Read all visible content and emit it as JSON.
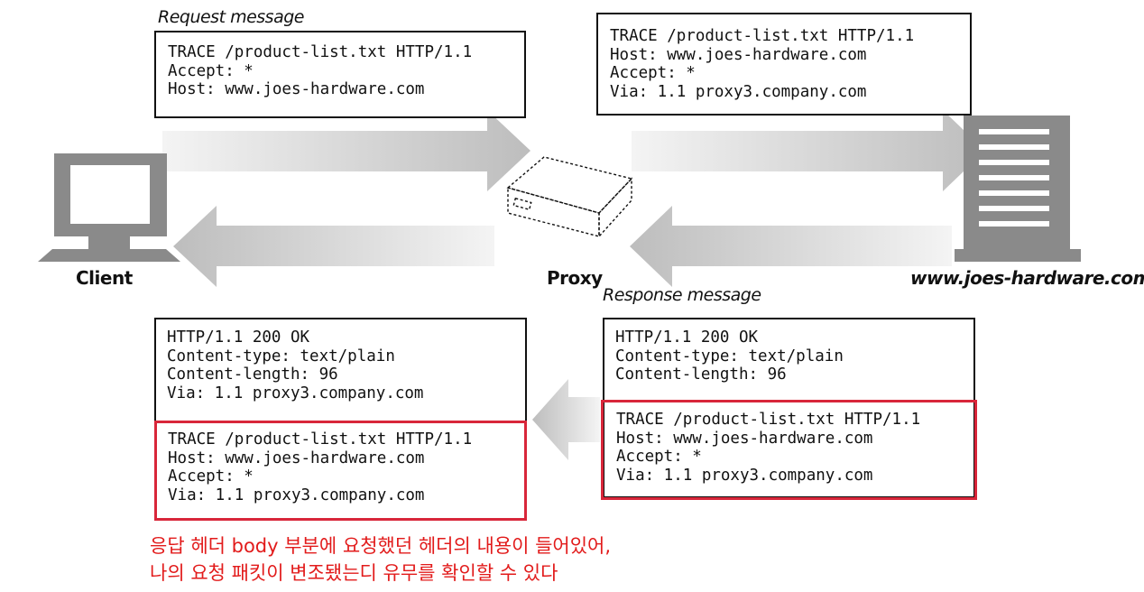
{
  "request": {
    "caption": "Request message",
    "client_box": [
      "TRACE /product-list.txt HTTP/1.1",
      "Accept: *",
      "Host: www.joes-hardware.com"
    ],
    "proxy_box": [
      "TRACE /product-list.txt HTTP/1.1",
      "Host: www.joes-hardware.com",
      "Accept: *",
      "Via: 1.1 proxy3.company.com"
    ]
  },
  "response": {
    "caption": "Response message",
    "client_box": {
      "headers": [
        "HTTP/1.1 200 OK",
        "Content-type: text/plain",
        "Content-length: 96",
        "Via: 1.1 proxy3.company.com"
      ],
      "body": [
        "TRACE /product-list.txt HTTP/1.1",
        "Host: www.joes-hardware.com",
        "Accept: *",
        "Via: 1.1 proxy3.company.com"
      ]
    },
    "server_box": {
      "headers": [
        "HTTP/1.1 200 OK",
        "Content-type: text/plain",
        "Content-length: 96"
      ],
      "body": [
        "TRACE /product-list.txt HTTP/1.1",
        "Host: www.joes-hardware.com",
        "Accept: *",
        "Via: 1.1 proxy3.company.com"
      ]
    }
  },
  "labels": {
    "client": "Client",
    "proxy": "Proxy",
    "server": "www.joes-hardware.com"
  },
  "note": [
    "응답 헤더 body 부분에 요청했던 헤더의 내용이 들어있어,",
    "나의 요청 패킷이 변조됐는디 유무를 확인할 수 있다"
  ],
  "colors": {
    "highlight": "#d8263a",
    "note_text": "#e21b1b",
    "arrow_gray": "#c8c8c8"
  }
}
